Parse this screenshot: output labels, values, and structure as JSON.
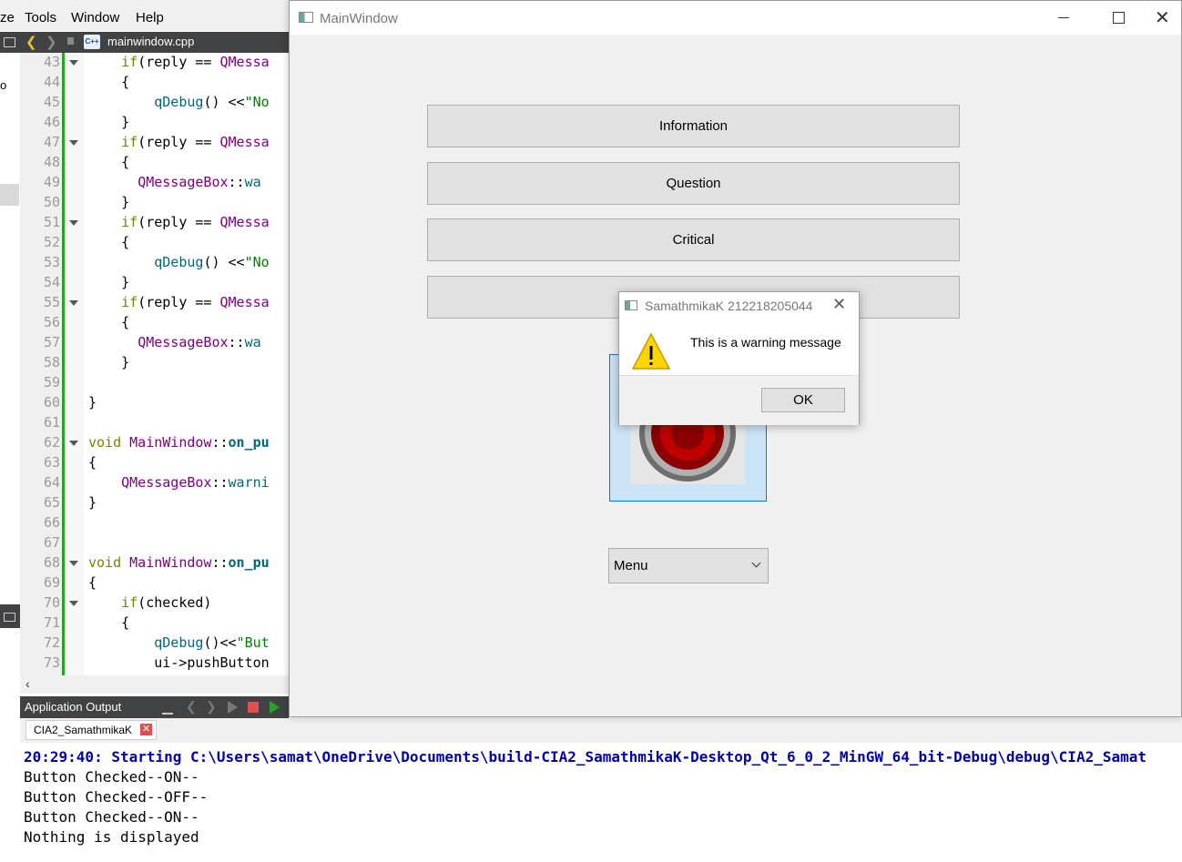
{
  "menubar": {
    "items": [
      "ze",
      "Tools",
      "Window",
      "Help"
    ]
  },
  "editor": {
    "file_tab": "mainwindow.cpp",
    "line_numbers": [
      "43",
      "44",
      "45",
      "46",
      "47",
      "48",
      "49",
      "50",
      "51",
      "52",
      "53",
      "54",
      "55",
      "56",
      "57",
      "58",
      "59",
      "60",
      "61",
      "62",
      "63",
      "64",
      "65",
      "66",
      "67",
      "68",
      "69",
      "70",
      "71",
      "72",
      "73"
    ],
    "lines": [
      {
        "seg": [
          {
            "t": "    "
          },
          {
            "t": "if",
            "c": "kw"
          },
          {
            "t": "(reply == "
          },
          {
            "t": "QMessa",
            "c": "cls"
          }
        ]
      },
      {
        "seg": [
          {
            "t": "    {"
          }
        ]
      },
      {
        "seg": [
          {
            "t": "        "
          },
          {
            "t": "qDebug",
            "c": "fn"
          },
          {
            "t": "() <<"
          },
          {
            "t": "\"No",
            "c": "str"
          }
        ]
      },
      {
        "seg": [
          {
            "t": "    }"
          }
        ]
      },
      {
        "seg": [
          {
            "t": "    "
          },
          {
            "t": "if",
            "c": "kw"
          },
          {
            "t": "(reply == "
          },
          {
            "t": "QMessa",
            "c": "cls"
          }
        ]
      },
      {
        "seg": [
          {
            "t": "    {"
          }
        ]
      },
      {
        "seg": [
          {
            "t": "      "
          },
          {
            "t": "QMessageBox",
            "c": "cls"
          },
          {
            "t": "::"
          },
          {
            "t": "wa",
            "c": "fn"
          }
        ]
      },
      {
        "seg": [
          {
            "t": "    }"
          }
        ]
      },
      {
        "seg": [
          {
            "t": "    "
          },
          {
            "t": "if",
            "c": "kw"
          },
          {
            "t": "(reply == "
          },
          {
            "t": "QMessa",
            "c": "cls"
          }
        ]
      },
      {
        "seg": [
          {
            "t": "    {"
          }
        ]
      },
      {
        "seg": [
          {
            "t": "        "
          },
          {
            "t": "qDebug",
            "c": "fn"
          },
          {
            "t": "() <<"
          },
          {
            "t": "\"No",
            "c": "str"
          }
        ]
      },
      {
        "seg": [
          {
            "t": "    }"
          }
        ]
      },
      {
        "seg": [
          {
            "t": "    "
          },
          {
            "t": "if",
            "c": "kw"
          },
          {
            "t": "(reply == "
          },
          {
            "t": "QMessa",
            "c": "cls"
          }
        ]
      },
      {
        "seg": [
          {
            "t": "    {"
          }
        ]
      },
      {
        "seg": [
          {
            "t": "      "
          },
          {
            "t": "QMessageBox",
            "c": "cls"
          },
          {
            "t": "::"
          },
          {
            "t": "wa",
            "c": "fn"
          }
        ]
      },
      {
        "seg": [
          {
            "t": "    }"
          }
        ]
      },
      {
        "seg": [
          {
            "t": ""
          }
        ]
      },
      {
        "seg": [
          {
            "t": "}"
          }
        ]
      },
      {
        "seg": [
          {
            "t": ""
          }
        ]
      },
      {
        "seg": [
          {
            "t": "void",
            "c": "kw"
          },
          {
            "t": " "
          },
          {
            "t": "MainWindow",
            "c": "cls"
          },
          {
            "t": "::"
          },
          {
            "t": "on_pu",
            "c": "bold"
          }
        ]
      },
      {
        "seg": [
          {
            "t": "{"
          }
        ]
      },
      {
        "seg": [
          {
            "t": "    "
          },
          {
            "t": "QMessageBox",
            "c": "cls"
          },
          {
            "t": "::"
          },
          {
            "t": "warni",
            "c": "fn"
          }
        ]
      },
      {
        "seg": [
          {
            "t": "}"
          }
        ]
      },
      {
        "seg": [
          {
            "t": ""
          }
        ]
      },
      {
        "seg": [
          {
            "t": ""
          }
        ]
      },
      {
        "seg": [
          {
            "t": "void",
            "c": "kw"
          },
          {
            "t": " "
          },
          {
            "t": "MainWindow",
            "c": "cls"
          },
          {
            "t": "::"
          },
          {
            "t": "on_pu",
            "c": "bold"
          }
        ]
      },
      {
        "seg": [
          {
            "t": "{"
          }
        ]
      },
      {
        "seg": [
          {
            "t": "    "
          },
          {
            "t": "if",
            "c": "kw"
          },
          {
            "t": "(checked)"
          }
        ]
      },
      {
        "seg": [
          {
            "t": "    {"
          }
        ]
      },
      {
        "seg": [
          {
            "t": "        "
          },
          {
            "t": "qDebug",
            "c": "fn"
          },
          {
            "t": "()<<"
          },
          {
            "t": "\"But",
            "c": "str"
          }
        ]
      },
      {
        "seg": [
          {
            "t": "        ui->pushButton"
          }
        ]
      }
    ],
    "fold_lines": [
      43,
      47,
      51,
      55,
      62,
      68,
      70
    ]
  },
  "output_pane": {
    "title": "Application Output",
    "tab_label": "CIA2_SamathmikaK",
    "lines": [
      "20:29:40: Starting C:\\Users\\samat\\OneDrive\\Documents\\build-CIA2_SamathmikaK-Desktop_Qt_6_0_2_MinGW_64_bit-Debug\\debug\\CIA2_Samat",
      "Button Checked--ON--",
      "Button Checked--OFF--",
      "Button Checked--ON--",
      "Nothing is displayed"
    ]
  },
  "main_window": {
    "title": "MainWindow",
    "buttons": [
      "Information",
      "Question",
      "Critical",
      ""
    ],
    "combo_value": "Menu"
  },
  "dialog": {
    "title": "SamathmikaK 212218205044",
    "message": "This is a warning message",
    "ok_label": "OK"
  },
  "colors": {
    "accent_blue": "#0000aa",
    "ide_dark": "#404244",
    "warning_yellow": "#ffd500"
  }
}
